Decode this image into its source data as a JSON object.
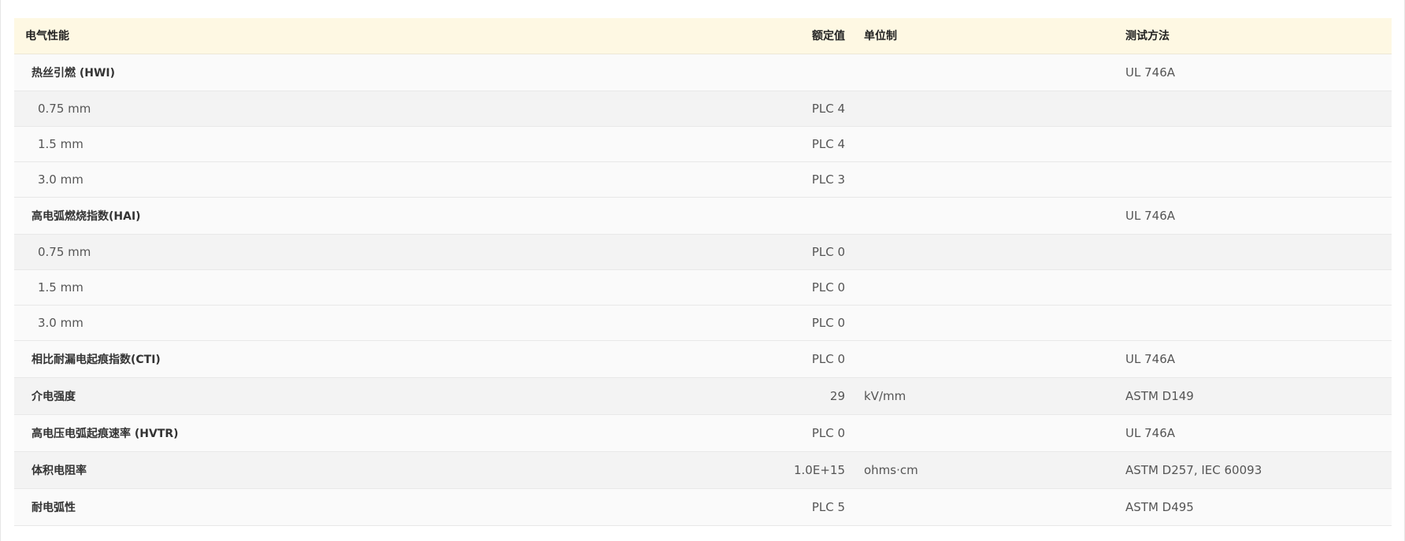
{
  "table": {
    "headers": {
      "property": "电气性能",
      "rated_value": "额定值",
      "unit": "单位制",
      "test_method": "测试方法"
    },
    "rows": [
      {
        "kind": "group",
        "name": "热丝引燃 (HWI)",
        "value": "",
        "unit": "",
        "method": "UL 746A"
      },
      {
        "kind": "sub",
        "name": "0.75 mm",
        "value": "PLC 4",
        "unit": "",
        "method": ""
      },
      {
        "kind": "sub",
        "name": "1.5 mm",
        "value": "PLC 4",
        "unit": "",
        "method": ""
      },
      {
        "kind": "sub",
        "name": "3.0 mm",
        "value": "PLC 3",
        "unit": "",
        "method": ""
      },
      {
        "kind": "group",
        "name": "高电弧燃烧指数(HAI)",
        "value": "",
        "unit": "",
        "method": "UL 746A"
      },
      {
        "kind": "sub",
        "name": "0.75 mm",
        "value": "PLC 0",
        "unit": "",
        "method": ""
      },
      {
        "kind": "sub",
        "name": "1.5 mm",
        "value": "PLC 0",
        "unit": "",
        "method": ""
      },
      {
        "kind": "sub",
        "name": "3.0 mm",
        "value": "PLC 0",
        "unit": "",
        "method": ""
      },
      {
        "kind": "group",
        "name": "相比耐漏电起痕指数(CTI)",
        "value": "PLC 0",
        "unit": "",
        "method": "UL 746A"
      },
      {
        "kind": "group",
        "name": "介电强度",
        "value": "29",
        "unit": "kV/mm",
        "method": "ASTM D149"
      },
      {
        "kind": "group",
        "name": "高电压电弧起痕速率 (HVTR)",
        "value": "PLC 0",
        "unit": "",
        "method": "UL 746A"
      },
      {
        "kind": "group",
        "name": "体积电阻率",
        "value": "1.0E+15",
        "unit": "ohms·cm",
        "method": "ASTM D257, IEC 60093"
      },
      {
        "kind": "group",
        "name": "耐电弧性",
        "value": "PLC 5",
        "unit": "",
        "method": "ASTM D495"
      }
    ]
  }
}
